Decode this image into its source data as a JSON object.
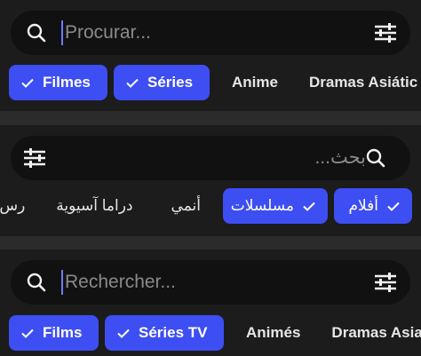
{
  "panels": [
    {
      "direction": "ltr",
      "search": {
        "placeholder": "Procurar..."
      },
      "chips": [
        {
          "label": "Filmes",
          "selected": true
        },
        {
          "label": "Séries",
          "selected": true
        },
        {
          "label": "Anime",
          "selected": false
        },
        {
          "label": "Dramas Asiátic",
          "selected": false
        }
      ]
    },
    {
      "direction": "rtl",
      "search": {
        "placeholder": "بحث..."
      },
      "chips": [
        {
          "label": "أفلام",
          "selected": true
        },
        {
          "label": "مسلسلات",
          "selected": true
        },
        {
          "label": "أنمي",
          "selected": false
        },
        {
          "label": "دراما آسيوية",
          "selected": false
        },
        {
          "label": "رس",
          "selected": false
        }
      ]
    },
    {
      "direction": "ltr",
      "search": {
        "placeholder": "Rechercher..."
      },
      "chips": [
        {
          "label": "Films",
          "selected": true
        },
        {
          "label": "Séries TV",
          "selected": true
        },
        {
          "label": "Animés",
          "selected": false
        },
        {
          "label": "Dramas Asia",
          "selected": false
        }
      ]
    }
  ],
  "icons": {
    "search": "search-icon",
    "filter": "filter-sliders-icon",
    "check": "check-icon"
  },
  "colors": {
    "background": "#2b2b2b",
    "panel": "#1c1c1c",
    "search_bar": "#111111",
    "accent": "#3d4ef2",
    "caret": "#6e7cff",
    "placeholder": "#8a8a8a",
    "text": "#e6e6e6"
  }
}
